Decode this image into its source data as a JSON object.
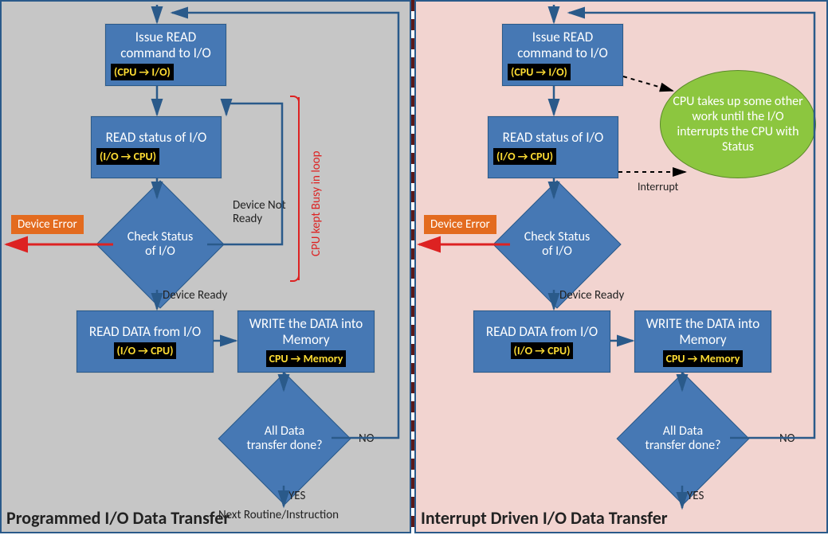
{
  "colors": {
    "box_fill": "#4678b4",
    "panel_left_bg": "#c6c6c6",
    "panel_right_bg": "#f2d4d0",
    "accent_yellow": "#ffdd33",
    "error_fill": "#e36b1f",
    "ellipse_fill": "#8cc63f"
  },
  "left": {
    "caption": "Programmed I/O Data Transfer",
    "issue": {
      "title": "Issue  READ command to  I/O",
      "sub": "(CPU → I/O)"
    },
    "status": {
      "title": "READ status of I/O",
      "sub": "(I/O → CPU)"
    },
    "check": {
      "title": "Check Status  of I/O"
    },
    "read": {
      "title": "READ DATA from I/O",
      "sub": "(I/O → CPU)"
    },
    "write": {
      "title": "WRITE the DATA into Memory",
      "sub": "CPU → Memory"
    },
    "alldone": {
      "title": "All  Data transfer done?"
    },
    "labels": {
      "device_error": "Device Error",
      "device_not_ready": "Device Not Ready",
      "device_ready": "Device Ready",
      "busy_loop": "CPU kept Busy in loop",
      "no": "NO",
      "yes": "YES",
      "next": "Next Routine/Instruction"
    }
  },
  "right": {
    "caption": "Interrupt Driven I/O Data Transfer",
    "issue": {
      "title": "Issue  READ command to  I/O",
      "sub": "(CPU → I/O)"
    },
    "status": {
      "title": "READ status of I/O",
      "sub": "(I/O → CPU)"
    },
    "check": {
      "title": "Check Status  of I/O"
    },
    "read": {
      "title": "READ DATA from I/O",
      "sub": "(I/O → CPU)"
    },
    "write": {
      "title": "WRITE the DATA into Memory",
      "sub": "CPU → Memory"
    },
    "alldone": {
      "title": "All  Data transfer done?"
    },
    "ellipse": "CPU takes up some other work until the I/O interrupts the CPU with Status",
    "labels": {
      "device_error": "Device Error",
      "device_ready": "Device Ready",
      "interrupt": "Interrupt",
      "no": "NO",
      "yes": "YES"
    }
  }
}
